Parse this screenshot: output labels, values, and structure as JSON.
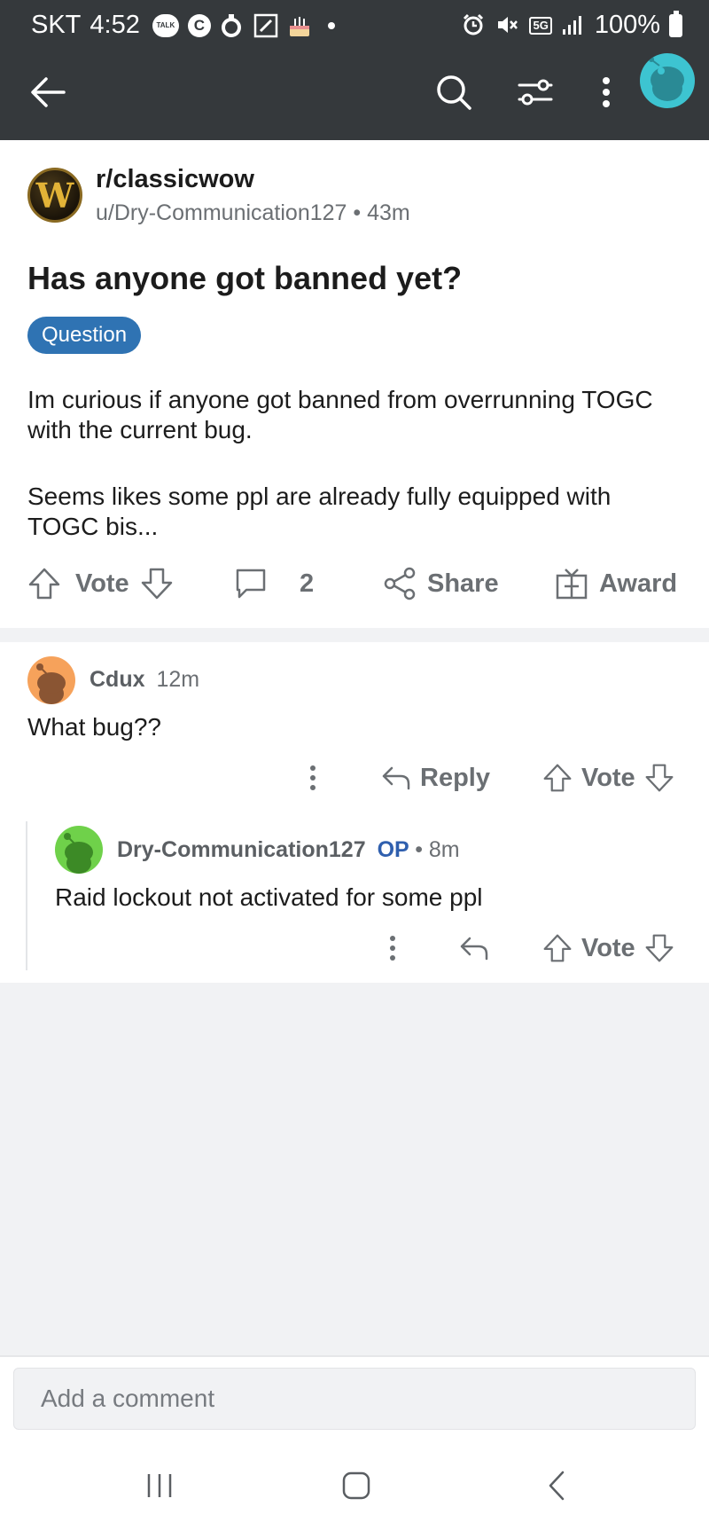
{
  "status_bar": {
    "carrier": "SKT",
    "time": "4:52",
    "talk_badge": "TALK",
    "c_badge": "C",
    "network": "5G",
    "battery": "100%"
  },
  "post": {
    "subreddit": "r/classicwow",
    "author": "u/Dry-Communication127",
    "age": "43m",
    "title": "Has anyone got banned yet?",
    "flair": "Question",
    "body": [
      "Im curious if anyone got banned from overrunning TOGC with the current bug.",
      "Seems likes some ppl are already fully equipped with TOGC bis..."
    ],
    "actions": {
      "vote_label": "Vote",
      "comment_count": "2",
      "share_label": "Share",
      "award_label": "Award"
    }
  },
  "comments": [
    {
      "author": "Cdux",
      "age": "12m",
      "text": "What bug??",
      "reply_label": "Reply",
      "vote_label": "Vote",
      "avatar_color": "#f6a25b"
    },
    {
      "author": "Dry-Communication127",
      "op_badge": "OP",
      "age": "8m",
      "text": "Raid lockout not activated for some ppl",
      "vote_label": "Vote",
      "avatar_color": "#6fd14a"
    }
  ],
  "composer": {
    "placeholder": "Add a comment"
  },
  "colors": {
    "topbar": "#35393c",
    "flair": "#2f73b3",
    "op": "#2f5fae",
    "user_avatar": "#3dc4d1"
  }
}
